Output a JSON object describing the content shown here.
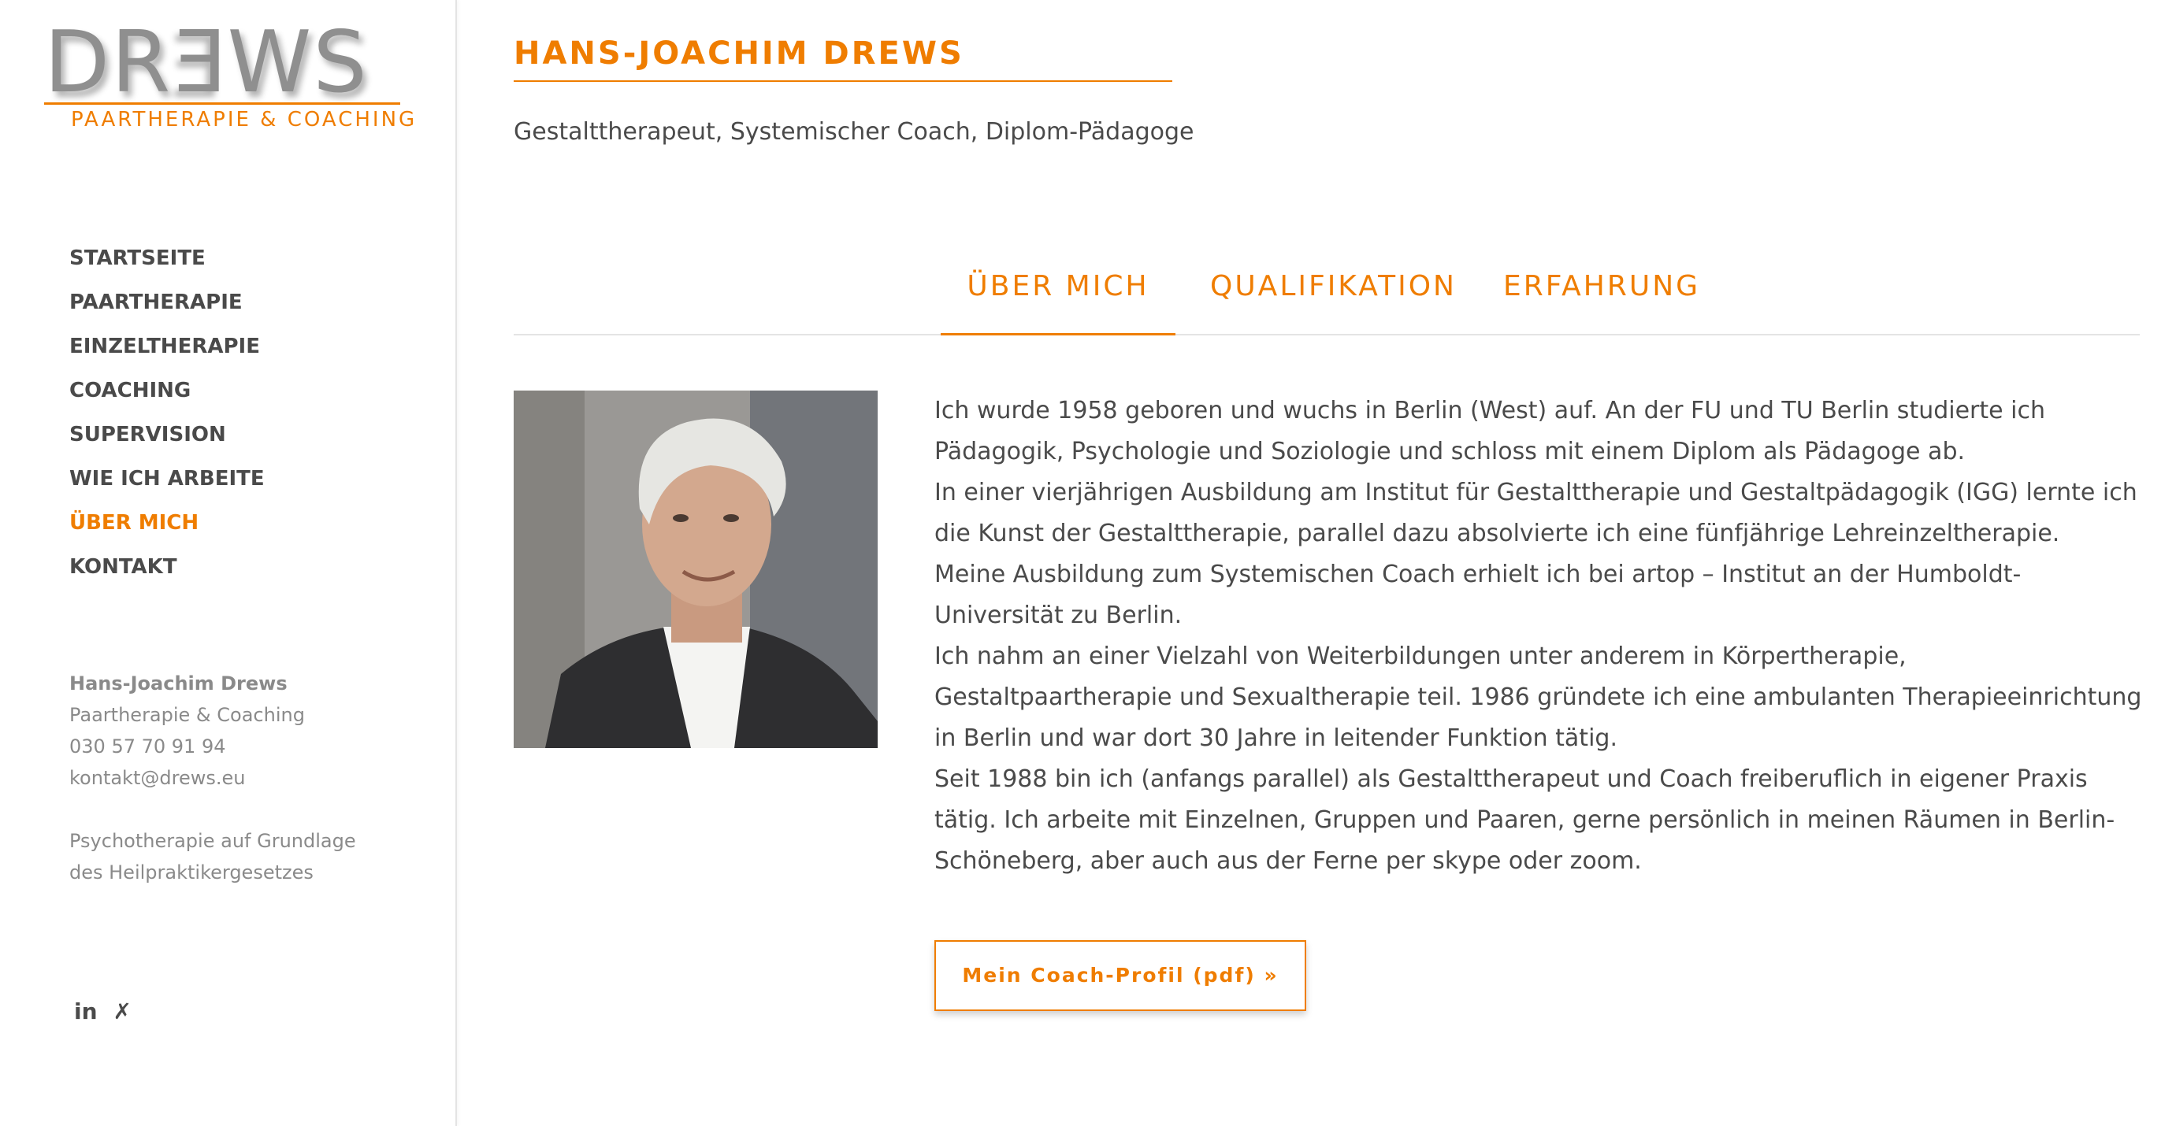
{
  "logo": {
    "word_before": "DR",
    "word_flipped": "E",
    "word_after": "WS",
    "tagline": "Paartherapie & Coaching"
  },
  "nav": {
    "items": [
      {
        "label": "STARTSEITE",
        "active": false
      },
      {
        "label": "PAARTHERAPIE",
        "active": false
      },
      {
        "label": "EINZELTHERAPIE",
        "active": false
      },
      {
        "label": "COACHING",
        "active": false
      },
      {
        "label": "SUPERVISION",
        "active": false
      },
      {
        "label": "WIE ICH ARBEITE",
        "active": false
      },
      {
        "label": "ÜBER MICH",
        "active": true
      },
      {
        "label": "KONTAKT",
        "active": false
      }
    ]
  },
  "contact": {
    "name": "Hans-Joachim Drews",
    "business": "Paartherapie & Coaching",
    "phone": "030 57 70 91 94",
    "email": "kontakt@drews.eu"
  },
  "legal": {
    "line1": "Psychotherapie auf Grundlage",
    "line2": "des Heilpraktikergesetzes"
  },
  "social": {
    "linkedin_label": "in",
    "xing_label": "✗"
  },
  "page": {
    "title": "Hans-Joachim Drews",
    "subtitle": "Gestalttherapeut, Systemischer Coach, Diplom-Pädagoge"
  },
  "tabs": [
    {
      "label": "Über mich",
      "active": true
    },
    {
      "label": "Qualifikation",
      "active": false
    },
    {
      "label": "Erfahrung",
      "active": false
    }
  ],
  "bio": {
    "lines": [
      "Ich wurde 1958 geboren und wuchs in Berlin (West) auf.  An der FU und TU Berlin studierte ich Pädagogik, Psychologie und Soziologie und schloss mit einem Diplom als Pädagoge ab.",
      "In einer vierjährigen Ausbildung am Institut für Gestalttherapie und Gestaltpädagogik (IGG) lernte ich die Kunst der Gestalttherapie, parallel dazu absolvierte ich eine fünfjährige Lehreinzeltherapie.",
      "Meine Ausbildung zum Systemischen Coach erhielt ich bei artop – Institut an der Humboldt-Universität zu Berlin.",
      "Ich nahm an einer Vielzahl von Weiterbildungen unter anderem in Körpertherapie, Gestaltpaartherapie und Sexualtherapie teil. 1986 gründete ich eine ambulanten Therapieeinrichtung in Berlin und war dort 30 Jahre in leitender Funktion tätig.",
      "Seit 1988 bin ich (anfangs parallel) als Gestalttherapeut und Coach freiberuflich in eigener Praxis tätig. Ich arbeite mit Einzelnen, Gruppen und Paaren, gerne persönlich in meinen Räumen in Berlin-Schöneberg, aber auch aus der Ferne per skype oder zoom."
    ]
  },
  "cta": {
    "label": "Mein Coach-Profil (pdf) »"
  },
  "colors": {
    "accent": "#ef7d00",
    "text": "#4a4a4a",
    "muted": "#8a8a8a"
  }
}
